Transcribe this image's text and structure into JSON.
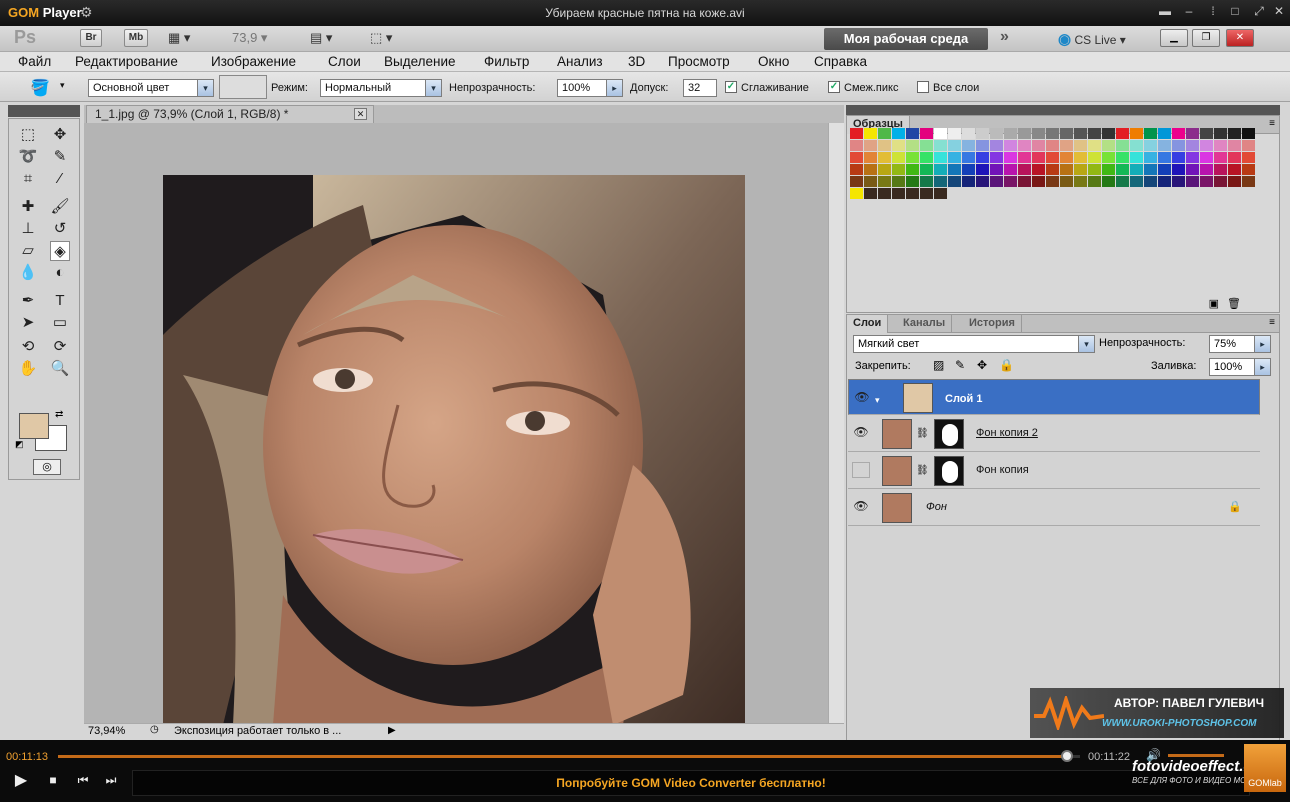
{
  "gom": {
    "logo_prefix": "GOM",
    "logo_suffix": "Player",
    "file_title": "Убираем красные пятна на коже.avi",
    "current_time": "00:11:13",
    "total_time": "00:11:22",
    "promo_text": "Попробуйте GOM Video Converter бесплатно!",
    "brand": "fotovideoeffect.com",
    "brand_sub": "ВСЕ ДЛЯ ФОТО И ВИДЕО МОНТАЖА!",
    "gomlab_label": "GOMlab",
    "progress_fraction": 0.987
  },
  "ps": {
    "logo": "Ps",
    "bridge_btn": "Br",
    "mini_bridge_btn": "Mb",
    "zoom_value": "73,9",
    "workspace_label": "Моя рабочая среда",
    "cslive_label": "CS Live",
    "menu": [
      "Файл",
      "Редактирование",
      "Изображение",
      "Слои",
      "Выделение",
      "Фильтр",
      "Анализ",
      "3D",
      "Просмотр",
      "Окно",
      "Справка"
    ],
    "options": {
      "fill_source": "Основной цвет",
      "mode_label": "Режим:",
      "mode_value": "Нормальный",
      "opacity_label": "Непрозрачность:",
      "opacity_value": "100%",
      "tolerance_label": "Допуск:",
      "tolerance_value": "32",
      "antialias_label": "Сглаживание",
      "contiguous_label": "Смеж.пикс",
      "all_layers_label": "Все слои"
    },
    "document": {
      "tab_title": "1_1.jpg @ 73,9% (Слой 1, RGB/8) *",
      "zoom_status": "73,94%",
      "status_text": "Экспозиция работает только в ..."
    },
    "swatches_tab": "Образцы",
    "layers_panel": {
      "tabs": [
        "Слои",
        "Каналы",
        "История"
      ],
      "blend_mode": "Мягкий свет",
      "opacity_label": "Непрозрачность:",
      "opacity_value": "75%",
      "lock_label": "Закрепить:",
      "fill_label": "Заливка:",
      "fill_value": "100%",
      "layers": [
        {
          "name": "Слой 1"
        },
        {
          "name": "Фон копия 2"
        },
        {
          "name": "Фон копия"
        },
        {
          "name": "Фон"
        }
      ],
      "footer_icons": [
        "link-icon",
        "fx-icon",
        "mask-icon",
        "adjustment-icon",
        "group-icon",
        "new-layer-icon",
        "trash-icon"
      ]
    },
    "colors": {
      "foreground": "#e0c8a6",
      "background": "#ffffff",
      "selected_layer": "#3a6fc4",
      "workspace_btn": "#555555"
    }
  },
  "watermark": {
    "author": "АВТОР: ПАВЕЛ ГУЛЕВИЧ",
    "url": "WWW.URОKI-PHOTOSHOP.COM"
  }
}
